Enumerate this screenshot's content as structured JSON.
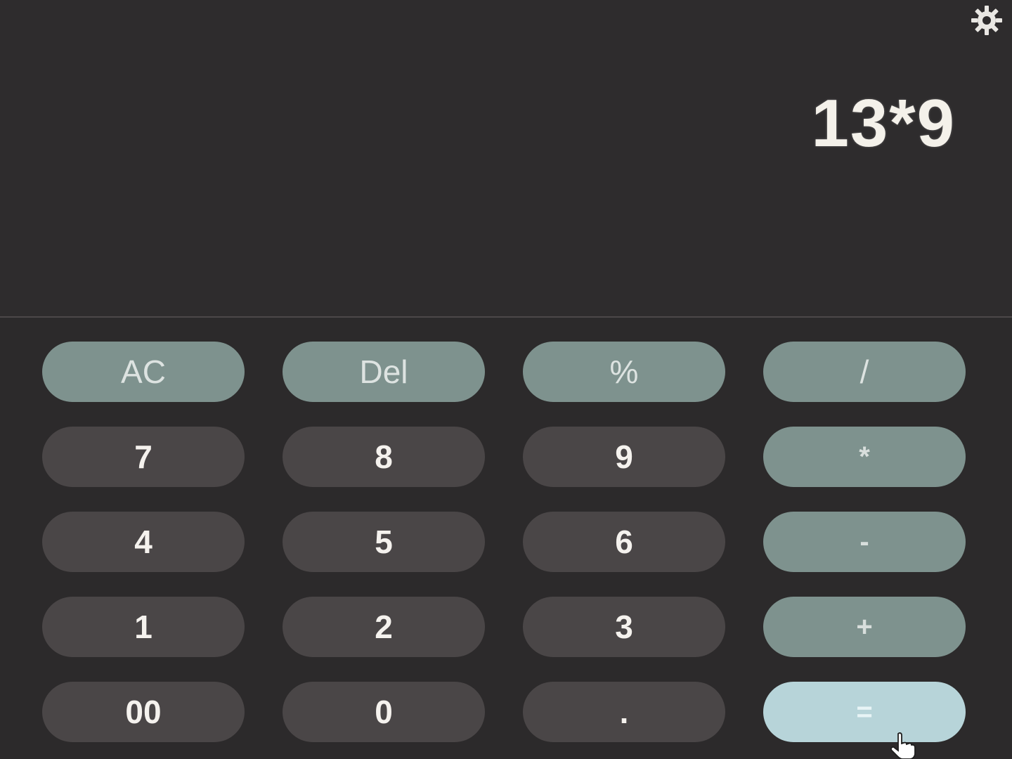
{
  "display": {
    "expression": "13*9"
  },
  "icons": {
    "settings": "gear-icon",
    "pointer": "hand-cursor-icon"
  },
  "colors": {
    "background": "#2e2c2d",
    "number_key": "#4a4647",
    "function_key": "#7e928e",
    "equals_key": "#b7d4d9"
  },
  "keys": {
    "ac": "AC",
    "del": "Del",
    "percent": "%",
    "divide": "/",
    "seven": "7",
    "eight": "8",
    "nine": "9",
    "multiply": "*",
    "four": "4",
    "five": "5",
    "six": "6",
    "subtract": "-",
    "one": "1",
    "two": "2",
    "three": "3",
    "add": "+",
    "double_zero": "00",
    "zero": "0",
    "decimal": ".",
    "equals": "="
  }
}
